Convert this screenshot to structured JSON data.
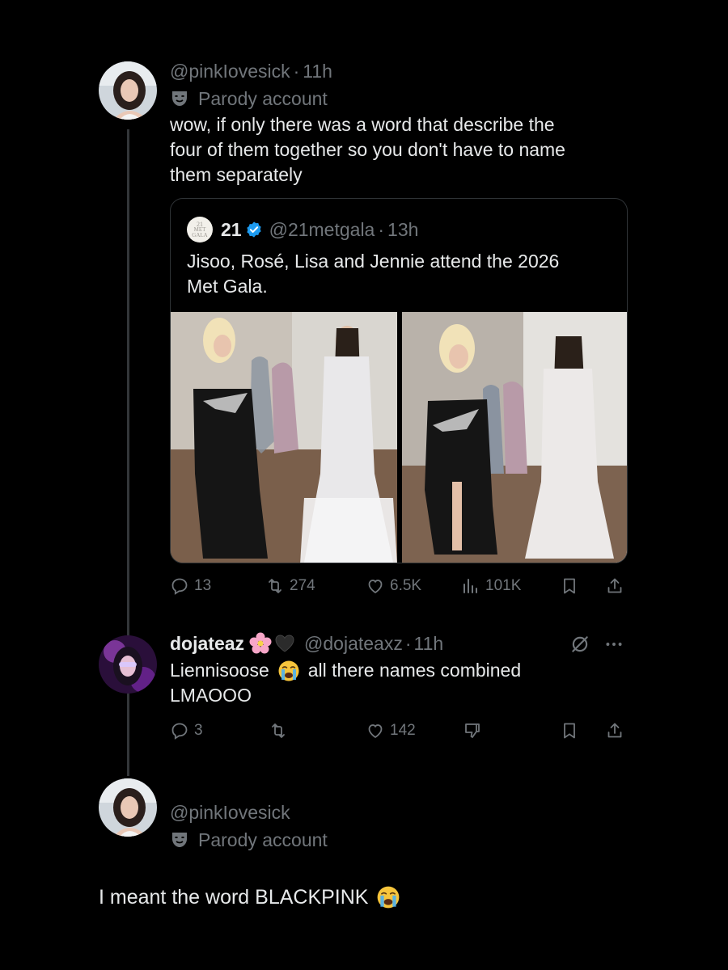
{
  "post1": {
    "handle": "@pinkIovesick",
    "sep": "·",
    "time": "11h",
    "label": "Parody account",
    "text_lines": [
      "wow, if only there was a word that describe the",
      "four of them together so you don't have to name",
      "them separately"
    ]
  },
  "quote": {
    "avatar_text": [
      "21",
      "MET",
      "GALA"
    ],
    "name": "21",
    "handle": "@21metgala",
    "sep": "·",
    "time": "13h",
    "text_lines": [
      "Jisoo, Rosé, Lisa and Jennie attend the 2026",
      "Met Gala."
    ]
  },
  "post1_actions": {
    "replies": "13",
    "reposts": "274",
    "likes": "6.5K",
    "views": "101K"
  },
  "reply": {
    "name": "dojateaz",
    "handle": "@dojateaxz",
    "sep": "·",
    "time": "11h",
    "text_line1_a": "Liennisoose",
    "text_line1_b": "all there names combined",
    "text_line2": "LMAOOO",
    "replies": "3",
    "likes": "142"
  },
  "post3": {
    "handle": "@pinkIovesick",
    "label": "Parody account",
    "text": "I meant the word BLACKPINK"
  },
  "icons": {
    "reply": "reply-icon",
    "repost": "repost-icon",
    "like": "heart-icon",
    "views": "views-icon",
    "bookmark": "bookmark-icon",
    "share": "share-icon",
    "dislike": "dislike-icon",
    "grok": "grok-icon",
    "more": "more-icon",
    "mask": "theater-mask-icon",
    "verified": "verified-badge-icon"
  },
  "colors": {
    "background": "#000000",
    "text": "#e7e9ea",
    "muted": "#71767b",
    "verified": "#1d9bf0",
    "border": "#2f3336"
  }
}
